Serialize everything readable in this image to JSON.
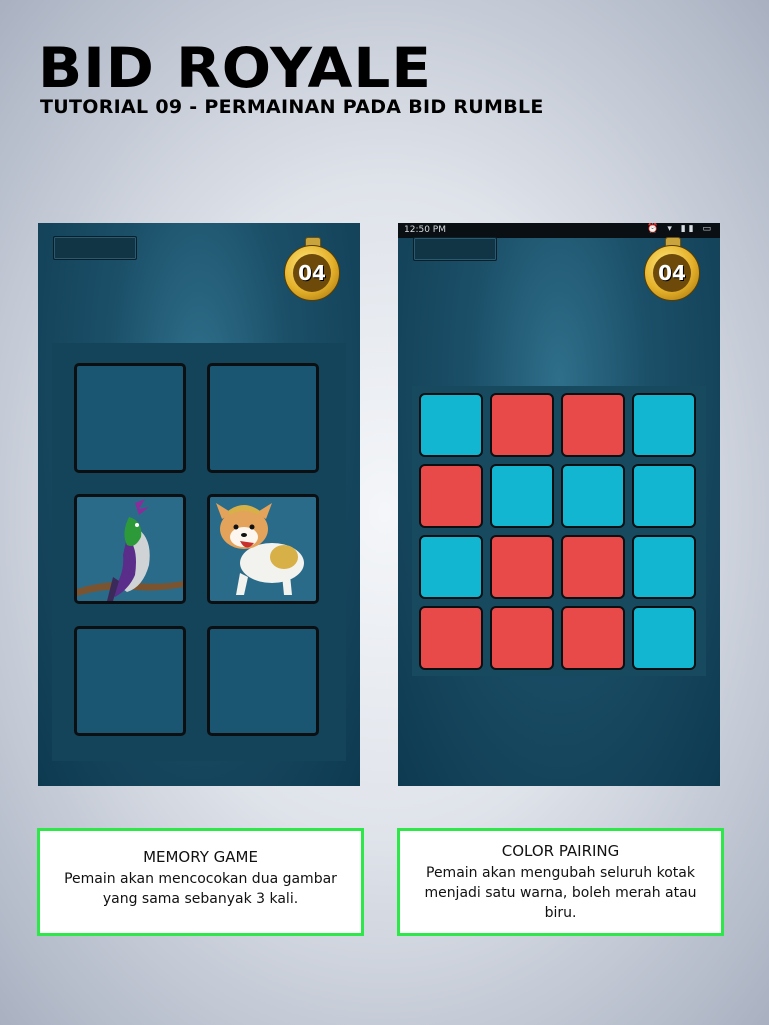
{
  "header": {
    "title": "BID ROYALE",
    "subtitle": "TUTORIAL 09 - PERMAINAN PADA BID RUMBLE"
  },
  "left_screen": {
    "timer": "04",
    "tiles": [
      "hidden",
      "hidden",
      "bird",
      "dog",
      "hidden",
      "hidden"
    ]
  },
  "right_screen": {
    "status_time": "12:50 PM",
    "status_icons": "⏰ ▾ ▮▮ ▭",
    "timer": "04",
    "grid": [
      [
        "blue",
        "red",
        "red",
        "blue"
      ],
      [
        "red",
        "blue",
        "blue",
        "blue"
      ],
      [
        "blue",
        "red",
        "red",
        "blue"
      ],
      [
        "red",
        "red",
        "red",
        "blue"
      ]
    ]
  },
  "colors": {
    "blue": "#12b6d1",
    "red": "#e84a4a",
    "frame_green": "#2ee84a"
  },
  "cards": {
    "memory": {
      "title": "MEMORY GAME",
      "text": "Pemain akan mencocokan dua gambar yang sama sebanyak 3 kali."
    },
    "color": {
      "title": "COLOR PAIRING",
      "text": "Pemain akan mengubah seluruh kotak menjadi satu warna, boleh merah atau biru."
    }
  }
}
